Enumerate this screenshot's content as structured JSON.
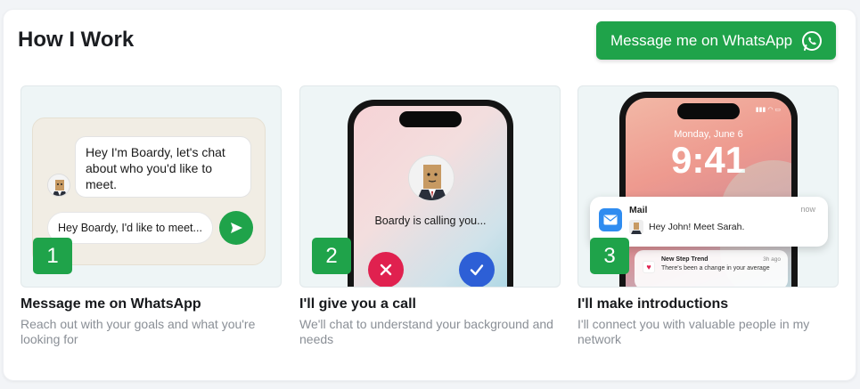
{
  "header": {
    "title": "How I Work",
    "whatsapp_button": "Message me on WhatsApp"
  },
  "steps": [
    {
      "number": "1",
      "title": "Message me on WhatsApp",
      "description": "Reach out with your goals and what you're looking for",
      "chat_bubble": "Hey I'm Boardy, let's chat about who you'd like to meet.",
      "input_text": "Hey Boardy, I'd like to meet..."
    },
    {
      "number": "2",
      "title": "I'll give you a call",
      "description": "We'll chat to understand your background and needs",
      "calling_text": "Boardy is calling you..."
    },
    {
      "number": "3",
      "title": "I'll make introductions",
      "description": "I'll connect you with valuable people in my network",
      "lock_date": "Monday, June 6",
      "lock_time": "9:41",
      "notif_app": "Mail",
      "notif_time": "now",
      "notif_text": "Hey John! Meet Sarah.",
      "notif2_title": "New Step Trend",
      "notif2_time": "3h ago",
      "notif2_text": "There's been a change in your average"
    }
  ],
  "colors": {
    "accent": "#1fa34a",
    "decline": "#e0214f",
    "accept": "#2d5fd6"
  }
}
